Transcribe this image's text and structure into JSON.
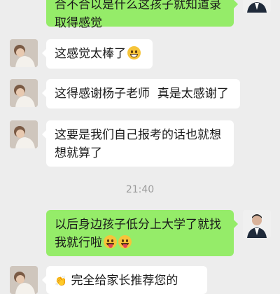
{
  "conversation": {
    "messages": [
      {
        "sender": "me",
        "lines": [
          "合不合以是什么这孩子就知道录",
          "取得感觉"
        ]
      },
      {
        "sender": "other",
        "text": "这感觉太棒了",
        "emoji": "grin-icon"
      },
      {
        "sender": "other",
        "text": "这得感谢杨子老师  真是太感谢了"
      },
      {
        "sender": "other",
        "lines": [
          "这要是我们自己报考的话也就想",
          "想就算了"
        ]
      },
      {
        "sender": "me",
        "lines": [
          "以后身边孩子低分上大学了就找",
          "我就行啦"
        ],
        "emoji": "wink-tongue-icon"
      },
      {
        "sender": "other",
        "text": "完全给家长推荐您的"
      }
    ],
    "timestamp": "21:40"
  },
  "colors": {
    "background": "#ededed",
    "my_bubble": "#95ec69",
    "other_bubble": "#ffffff"
  }
}
